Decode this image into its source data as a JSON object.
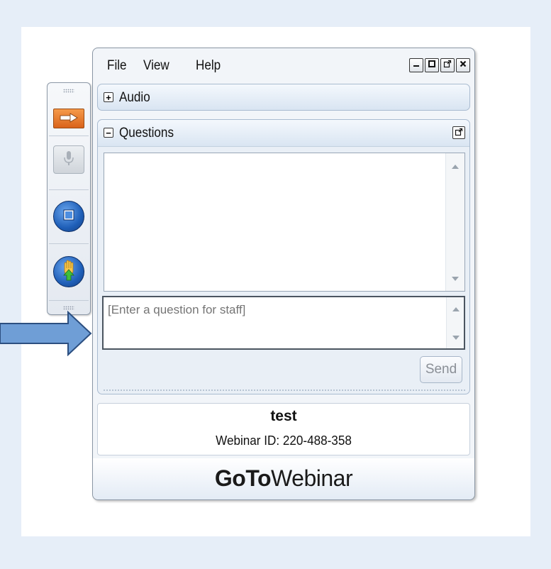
{
  "menu": {
    "file": "File",
    "view": "View",
    "help": "Help"
  },
  "window_buttons": [
    "minimize",
    "restore",
    "popout",
    "close"
  ],
  "sections": {
    "audio": {
      "toggle": "+",
      "label": "Audio"
    },
    "questions": {
      "toggle": "−",
      "label": "Questions"
    }
  },
  "question_input": {
    "placeholder": "[Enter a question for staff]"
  },
  "send_button": {
    "label": "Send"
  },
  "session": {
    "name": "test",
    "webinar_id": "Webinar ID: 220-488-358"
  },
  "brand": {
    "bold": "GoTo",
    "regular": "Webinar"
  },
  "colors": {
    "accent_orange": "#e8782a",
    "circle_blue": "#1f5fb8",
    "arrow_blue": "#6f9ed6",
    "page_bg": "#e6eef8"
  },
  "icons": {
    "strip": [
      "arrow-right-icon",
      "microphone-icon",
      "screen-icon",
      "raise-hand-icon"
    ]
  }
}
